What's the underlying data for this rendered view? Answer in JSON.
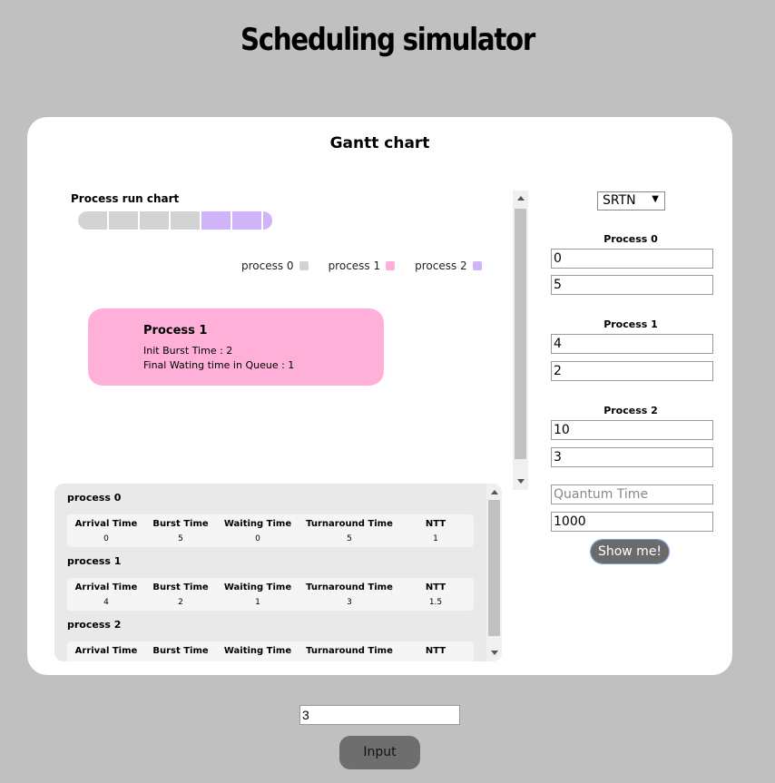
{
  "header": {
    "title": "Scheduling simulator"
  },
  "gantt": {
    "title": "Gantt chart",
    "run_label": "Process run chart",
    "run_sequence": [
      "process 0",
      "process 0",
      "process 0",
      "process 0",
      "process 2",
      "process 2",
      "process 2"
    ],
    "legend": [
      {
        "label": "process 0",
        "color": "#d3d3d3"
      },
      {
        "label": "process 1",
        "color": "#ffb0d8"
      },
      {
        "label": "process 2",
        "color": "#d0b4fa"
      }
    ],
    "popup": {
      "title": "Process 1",
      "init_burst": "Init Burst Time : 2",
      "final_wait": "Final Wating time in Queue : 1"
    }
  },
  "results": {
    "columns": [
      "Arrival Time",
      "Burst Time",
      "Waiting Time",
      "Turnaround Time",
      "NTT"
    ],
    "processes": [
      {
        "name": "process 0",
        "values": [
          "0",
          "5",
          "0",
          "5",
          "1"
        ]
      },
      {
        "name": "process 1",
        "values": [
          "4",
          "2",
          "1",
          "3",
          "1.5"
        ]
      },
      {
        "name": "process 2",
        "values": []
      }
    ]
  },
  "controls": {
    "algorithm": "SRTN",
    "processes": [
      {
        "label": "Process 0",
        "arrival": "0",
        "burst": "5"
      },
      {
        "label": "Process 1",
        "arrival": "4",
        "burst": "2"
      },
      {
        "label": "Process 2",
        "arrival": "10",
        "burst": "3"
      }
    ],
    "quantum_placeholder": "Quantum Time",
    "quantum_value": "",
    "extra_value": "1000",
    "show_label": "Show me!"
  },
  "footer": {
    "count_value": "3",
    "input_label": "Input"
  },
  "colors": {
    "background": "#c0c0c0",
    "card": "#ffffff",
    "button": "#6b6b6b"
  }
}
